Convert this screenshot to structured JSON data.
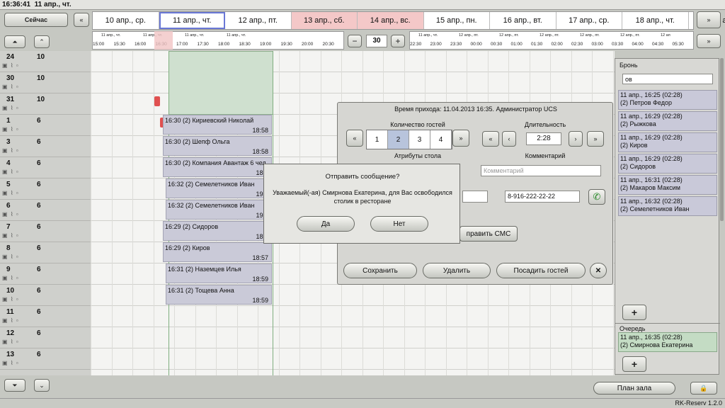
{
  "header": {
    "clock": "16:36:41",
    "date": "11 апр., чт."
  },
  "nav": {
    "now_label": "Сейчас",
    "prev_icon": "«",
    "next_icon": "»"
  },
  "dates": [
    "10 апр., ср.",
    "11 апр., чт.",
    "12 апр., пт.",
    "13 апр., сб.",
    "14 апр., вс.",
    "15 апр., пн.",
    "16 апр., вт.",
    "17 апр., ср.",
    "18 апр., чт.",
    "19 ап"
  ],
  "weekend_color": "#f4c8c8",
  "zoom": {
    "minus": "−",
    "value": "30",
    "plus": "+"
  },
  "timeline1": {
    "day_labels": [
      "11 апр., чт.",
      "11 апр., чт.",
      "11 апр., чт.",
      "11 апр., чт."
    ],
    "times": [
      "15:00",
      "15:30",
      "16:00",
      "16:30",
      "17:00",
      "17:30",
      "18:00",
      "18:30",
      "19:00",
      "19:30",
      "20:00",
      "20:30"
    ]
  },
  "timeline2": {
    "day_labels": [
      "11 апр., чт.",
      "12 апр., пт.",
      "12 апр., пт.",
      "12 апр., пт.",
      "12 апр., пт.",
      "12 апр., пт.",
      "12 ап"
    ],
    "times": [
      "22:30",
      "23:00",
      "23:30",
      "00:00",
      "00:30",
      "01:00",
      "01:30",
      "02:00",
      "02:30",
      "03:00",
      "03:30",
      "04:00",
      "04:30",
      "05:30"
    ]
  },
  "tables": [
    {
      "num": "24",
      "cap": "10"
    },
    {
      "num": "30",
      "cap": "10"
    },
    {
      "num": "31",
      "cap": "10"
    },
    {
      "num": "1",
      "cap": "6"
    },
    {
      "num": "3",
      "cap": "6"
    },
    {
      "num": "4",
      "cap": "6"
    },
    {
      "num": "5",
      "cap": "6"
    },
    {
      "num": "6",
      "cap": "6"
    },
    {
      "num": "7",
      "cap": "6"
    },
    {
      "num": "8",
      "cap": "6"
    },
    {
      "num": "9",
      "cap": "6"
    },
    {
      "num": "10",
      "cap": "6"
    },
    {
      "num": "11",
      "cap": "6"
    },
    {
      "num": "12",
      "cap": "6"
    },
    {
      "num": "13",
      "cap": "6"
    }
  ],
  "reservations": [
    {
      "name": "16:30 (2) Кириевский Николай",
      "end": "18:58"
    },
    {
      "name": "16:30 (2) Шепф Ольга",
      "end": "18:58"
    },
    {
      "name": "16:30 (2) Компания Авантаж 6 чел",
      "end": "18:5"
    },
    {
      "name": "16:32 (2) Семелетников Иван",
      "end": "19:0"
    },
    {
      "name": "16:32 (2) Семелетников Иван",
      "end": "19:0"
    },
    {
      "name": "16:29 (2) Сидоров",
      "end": "18:5"
    },
    {
      "name": "16:29 (2) Киров",
      "end": "18:57"
    },
    {
      "name": "16:31 (2) Наземцев Илья",
      "end": "18:59"
    },
    {
      "name": "16:31 (2) Тощева Анна",
      "end": "18:59"
    }
  ],
  "panel": {
    "bookings_title": "Бронь",
    "search_value": "ов",
    "bookings": [
      {
        "l1": "11 апр., 16:25  (02:28)",
        "l2": "(2) Петров Федор"
      },
      {
        "l1": "11 апр., 16:29  (02:28)",
        "l2": "(2) Рыжкова"
      },
      {
        "l1": "11 апр., 16:29  (02:28)",
        "l2": "(2) Киров"
      },
      {
        "l1": "11 апр., 16:29  (02:28)",
        "l2": "(2) Сидоров"
      },
      {
        "l1": "11 апр., 16:31  (02:28)",
        "l2": "(2) Макаров Максим"
      },
      {
        "l1": "11 апр., 16:32  (02:28)",
        "l2": "(2) Семелетников Иван"
      }
    ],
    "add_label": "+",
    "queue_title": "Очередь",
    "queue": [
      {
        "l1": "11 апр., 16:35  (02:28)",
        "l2": "(2) Смирнова Екатерина"
      }
    ],
    "hall_plan": "План зала",
    "queue_color": "#c4dcc4"
  },
  "dialog": {
    "title": "Время прихода: 11.04.2013 16:35. Администратор UCS",
    "guests_label": "Количество гостей",
    "guests": [
      "1",
      "2",
      "3",
      "4"
    ],
    "duration_label": "Длительность",
    "duration": "2:28",
    "attrs_label": "Атрибуты стола",
    "comment_label": "Комментарий",
    "comment_placeholder": "Комментарий",
    "phone": "8-916-222-22-22",
    "sms_label": "править СМС",
    "save": "Сохранить",
    "delete": "Удалить",
    "seat": "Посадить гостей",
    "close": "✕"
  },
  "message": {
    "title": "Отправить сообщение?",
    "text": "Уважаемый(-ая) Смирнова Екатерина, для Вас освободился столик в ресторане",
    "yes": "Да",
    "no": "Нет"
  },
  "version": "RK-Reserv 1.2.0"
}
